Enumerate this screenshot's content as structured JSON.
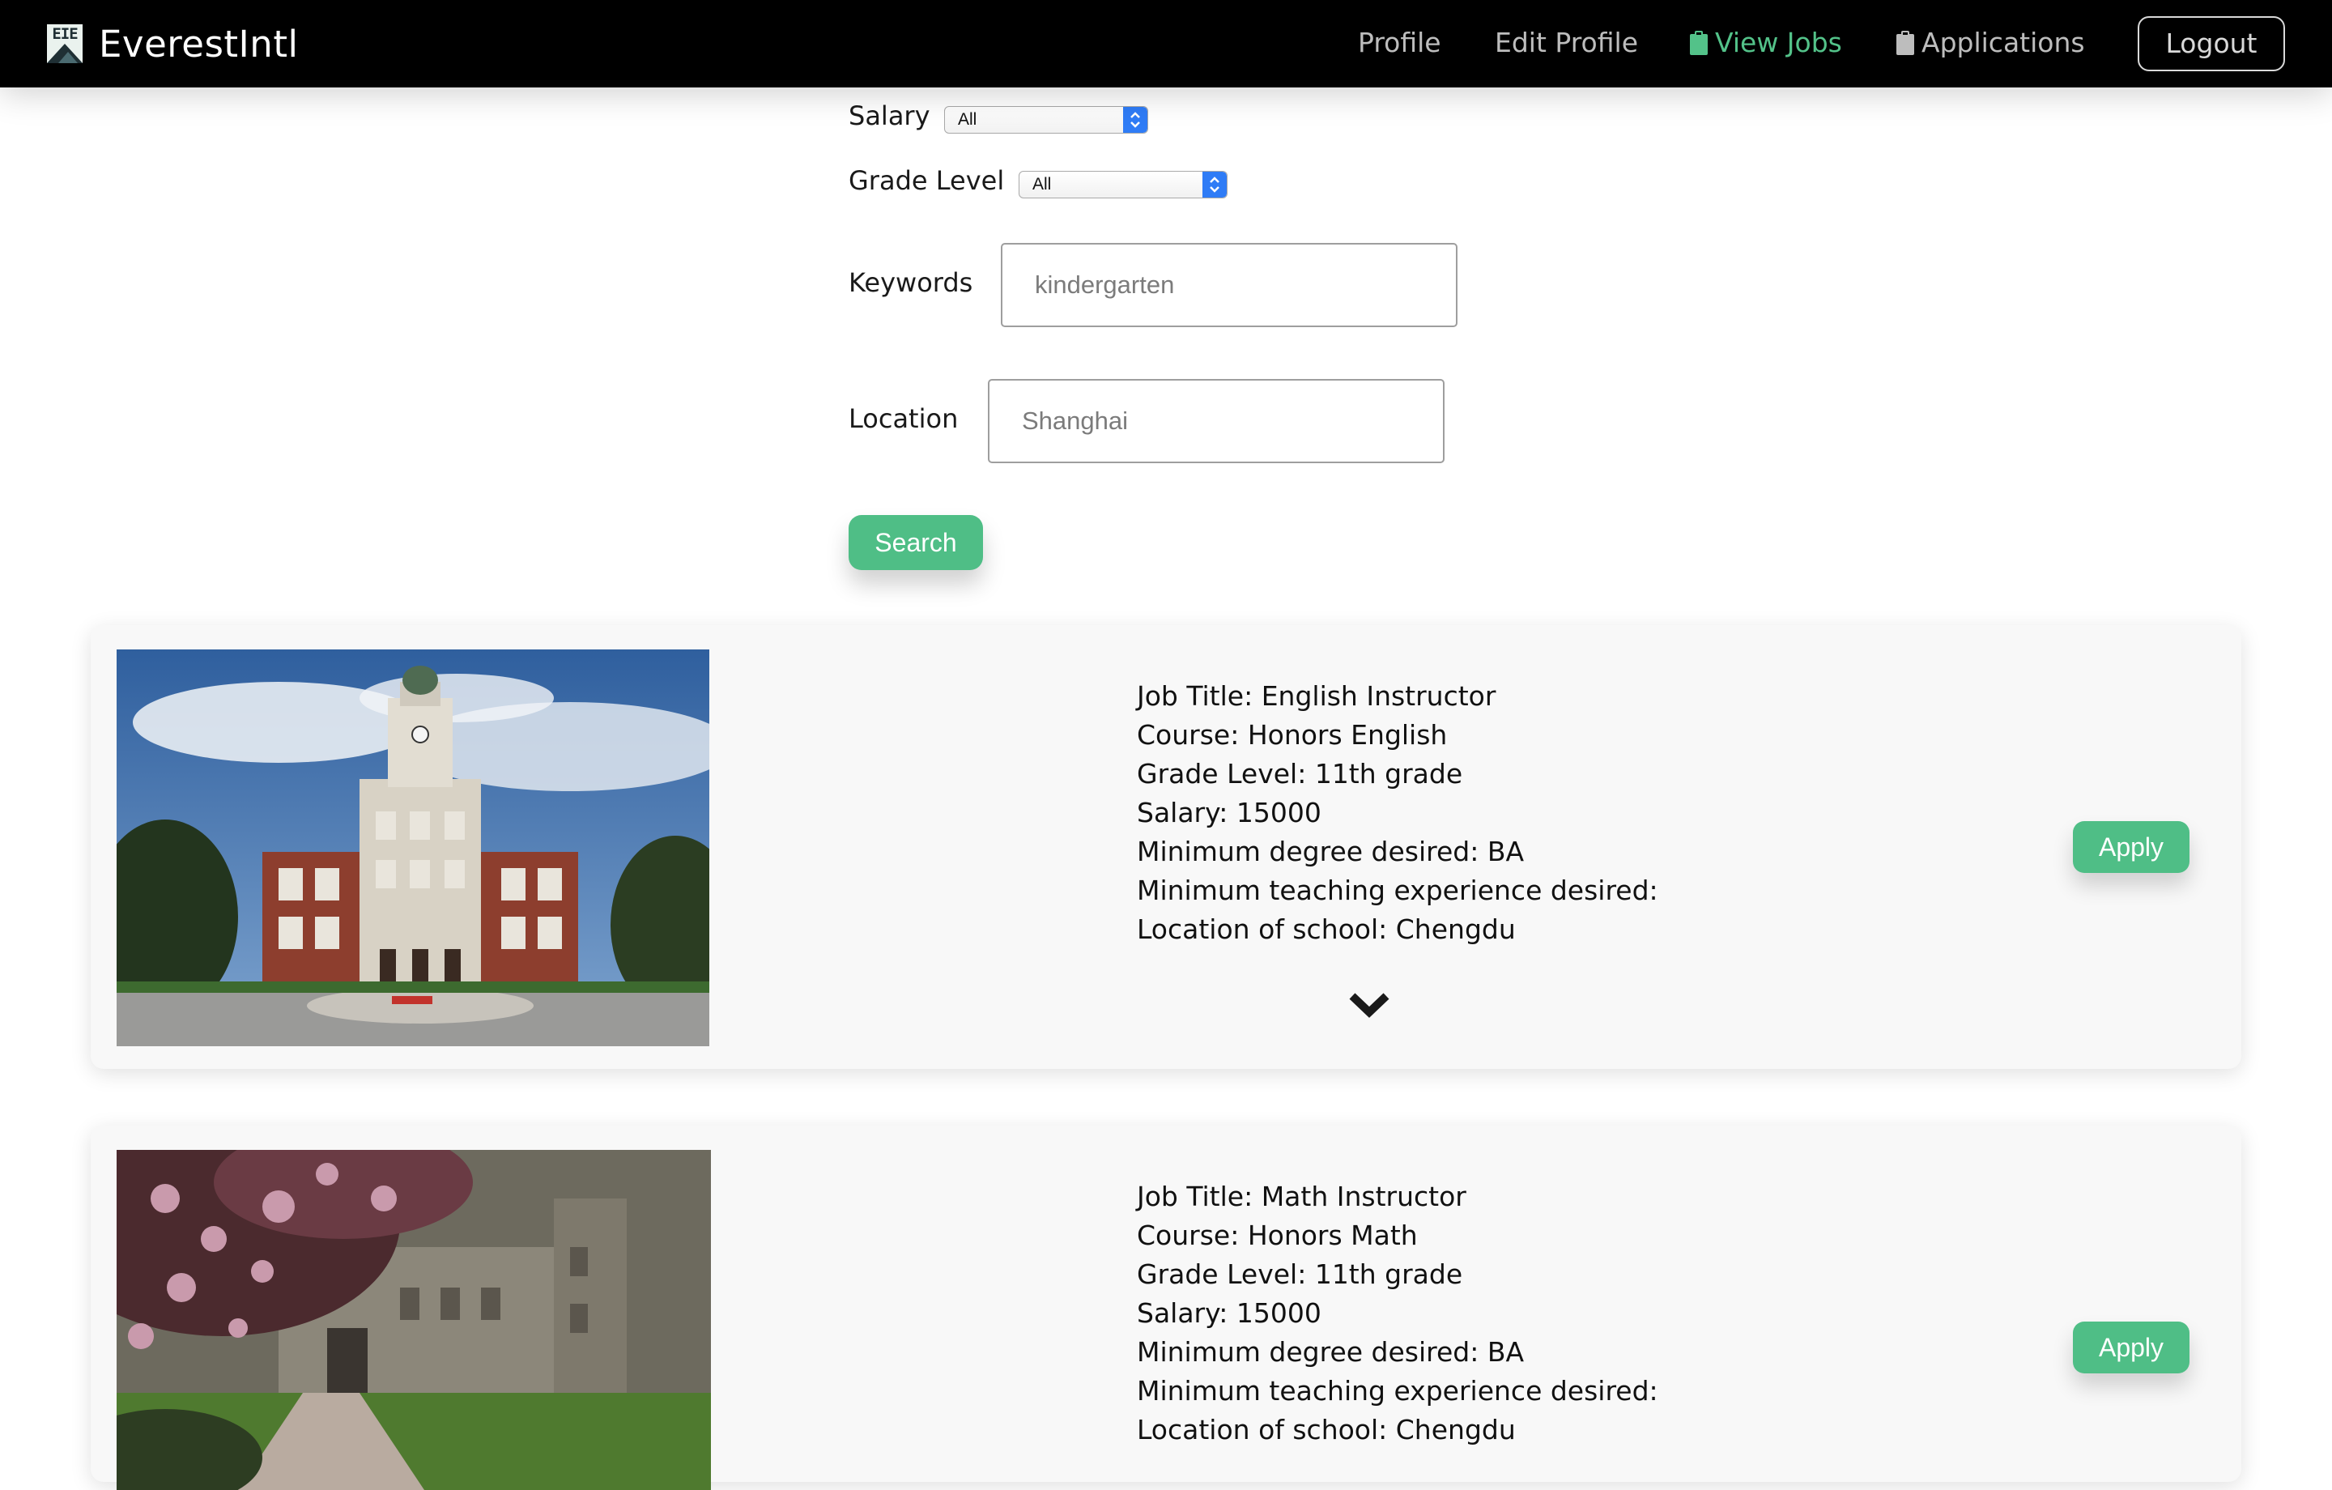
{
  "nav": {
    "brand": "EverestIntl",
    "logo_text": "EIE",
    "items": [
      {
        "label": "Profile"
      },
      {
        "label": "Edit Profile"
      },
      {
        "label": "View Jobs",
        "active": true,
        "icon": "clipboard-icon"
      },
      {
        "label": "Applications",
        "icon": "clipboard-icon"
      }
    ],
    "logout_label": "Logout"
  },
  "filters": {
    "salary_label": "Salary",
    "salary_value": "All",
    "grade_label": "Grade Level",
    "grade_value": "All",
    "keywords_label": "Keywords",
    "keywords_placeholder": "kindergarten",
    "location_label": "Location",
    "location_placeholder": "Shanghai",
    "search_label": "Search"
  },
  "jobs": [
    {
      "title": "Job Title: English Instructor",
      "course": "Course: Honors English",
      "grade": "Grade Level: 11th grade",
      "salary": "Salary: 15000",
      "degree": "Minimum degree desired: BA",
      "experience": "Minimum teaching experience desired:",
      "location": "Location of school: Chengdu",
      "apply_label": "Apply"
    },
    {
      "title": "Job Title: Math Instructor",
      "course": "Course: Honors Math",
      "grade": "Grade Level: 11th grade",
      "salary": "Salary: 15000",
      "degree": "Minimum degree desired: BA",
      "experience": "Minimum teaching experience desired:",
      "location": "Location of school: Chengdu",
      "apply_label": "Apply"
    }
  ],
  "colors": {
    "accent": "#4fbe86",
    "nav_active": "#53c289",
    "navbar_bg": "#000000"
  }
}
